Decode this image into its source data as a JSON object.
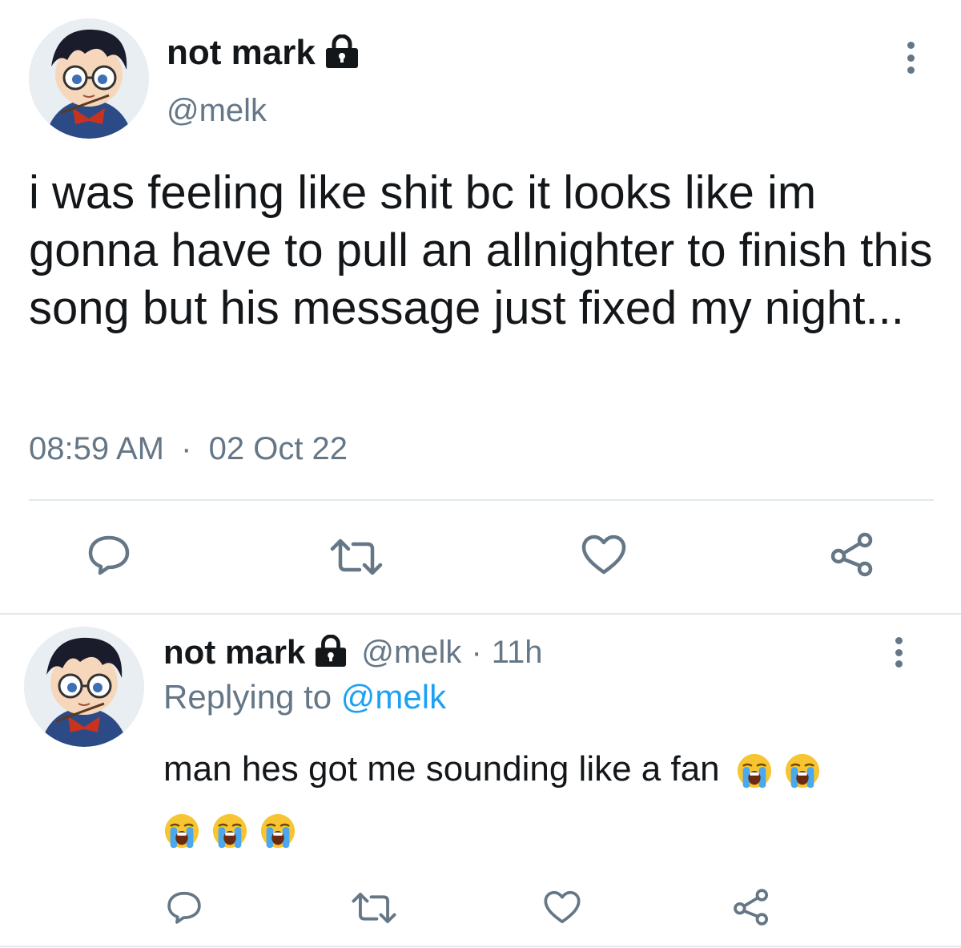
{
  "main_tweet": {
    "display_name": "not mark",
    "handle": "@melk",
    "text": "i was feeling like shit bc it looks like im gonna have to pull an allnighter to finish this song but his message just fixed my night...",
    "time": "08:59 AM",
    "separator": "·",
    "date": "02 Oct 22"
  },
  "reply_tweet": {
    "display_name": "not mark",
    "handle": "@melk",
    "separator": "·",
    "age": "11h",
    "replying_prefix": "Replying to",
    "replying_handle": "@melk",
    "text": "man hes got me sounding like a fan",
    "emoji_count": 5,
    "emoji": "loudly-crying-face"
  },
  "icons": {
    "lock": "lock-icon",
    "more": "more-vertical-icon",
    "reply": "reply-icon",
    "retweet": "retweet-icon",
    "like": "heart-icon",
    "share": "share-icon"
  },
  "colors": {
    "text": "#14171a",
    "muted": "#657786",
    "link": "#1da1f2",
    "divider": "#e1e8ed"
  }
}
